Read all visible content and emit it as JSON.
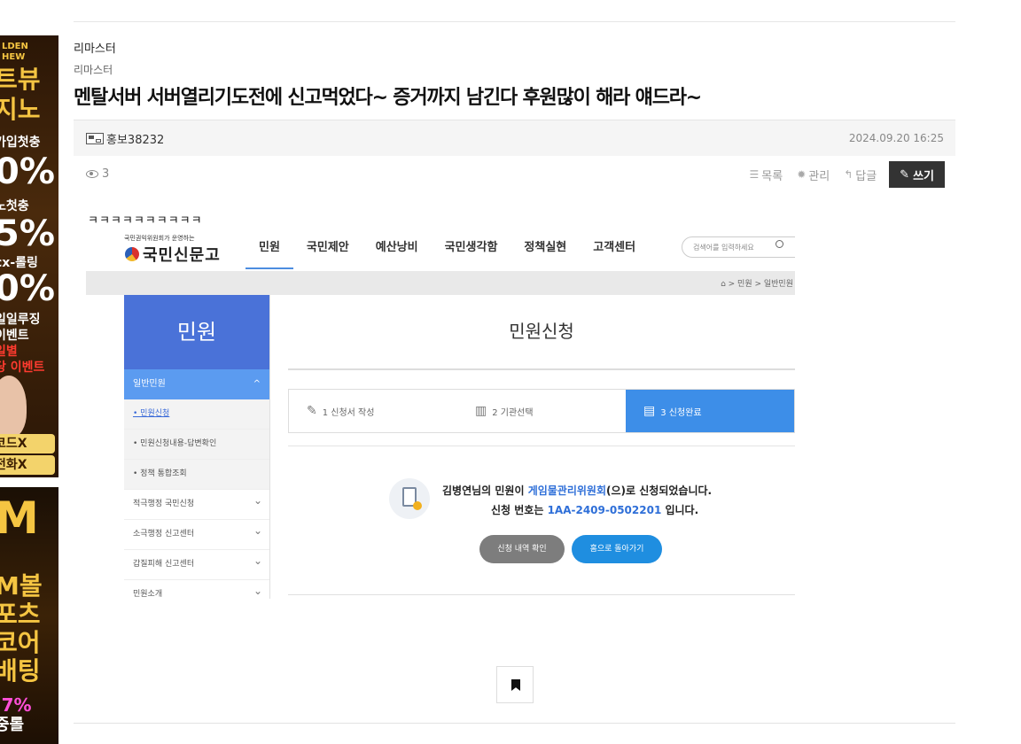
{
  "banner_ads": {
    "ad1": {
      "lines": [
        "LDEN",
        "HEW",
        "트뷰",
        "지노",
        "가입첫충",
        "0%",
        "노첫충",
        "5%",
        "cx-롤링",
        "0%",
        "일일루징",
        "이벤트",
        "일별",
        "당 이벤트",
        "코드X",
        "전화X"
      ]
    },
    "ad2": {
      "lines": [
        "M",
        "M볼",
        "포츠",
        "코어",
        "배팅",
        ".7%",
        "중롤"
      ]
    }
  },
  "post": {
    "category_top": "리마스터",
    "category": "리마스터",
    "title": "멘탈서버 서버열리기도전에 신고먹었다~ 증거까지 남긴다 후원많이 해라 얘드라~",
    "author": "홍보38232",
    "date": "2024.09.20 16:25",
    "views": "3",
    "body_text": "ㅋㅋㅋㅋㅋㅋㅋㅋㅋㅋ"
  },
  "actions": {
    "list_label": "목록",
    "manage_label": "관리",
    "reply_label": "답글",
    "write_label": "쓰기"
  },
  "embedded_screenshot": {
    "site_tagline": "국민권익위원회가 운영하는",
    "site_name": "국민신문고",
    "nav": [
      "민원",
      "국민제안",
      "예산낭비",
      "국민생각함",
      "정책실현",
      "고객센터"
    ],
    "search_placeholder": "검색어를 입력하세요",
    "breadcrumb": "⌂ > 민원 > 일반민원",
    "sidebar_title": "민원",
    "sidebar_section": "일반민원",
    "sidebar_items": [
      "• 민원신청",
      "• 민원신청내용-답변확인",
      "• 정책 통합조회",
      "적극행정 국민신청",
      "소극행정 신고센터",
      "갑질피해 신고센터",
      "민원소개"
    ],
    "page_title": "민원신청",
    "steps": [
      "1 신청서 작성",
      "2 기관선택",
      "3 신청완료"
    ],
    "result_line1_prefix": "김병연님의 민원이 ",
    "result_line1_org": "게임물관리위원회",
    "result_line1_suffix": "(으)로 신청되었습니다.",
    "result_line2_prefix": "신청 번호는 ",
    "result_line2_number": "1AA-2409-0502201",
    "result_line2_suffix": " 입니다.",
    "btn_check": "신청 내역 확인",
    "btn_home": "홈으로 돌아가기"
  }
}
